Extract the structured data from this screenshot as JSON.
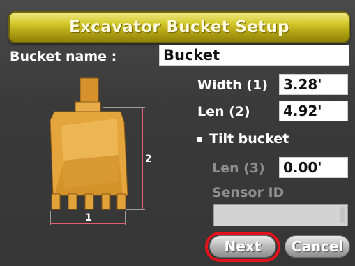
{
  "title": "Excavator Bucket Setup",
  "bucket_name": {
    "label": "Bucket name :",
    "value": "Bucket"
  },
  "width": {
    "label": "Width (1)",
    "value": "3.28'"
  },
  "len2": {
    "label": "Len (2)",
    "value": "4.92'"
  },
  "tilt_bucket": {
    "label": "Tilt bucket"
  },
  "len3": {
    "label": "Len (3)",
    "value": "0.00'"
  },
  "sensor": {
    "label": "Sensor ID",
    "value": ""
  },
  "diagram": {
    "label_1": "1",
    "label_2": "2"
  },
  "buttons": {
    "next": "Next",
    "cancel": "Cancel"
  },
  "colors": {
    "title_bar": "#c6b821",
    "highlight": "#e2131b",
    "bucket": "#e2a23a",
    "dimension_line": "#e35d72"
  }
}
